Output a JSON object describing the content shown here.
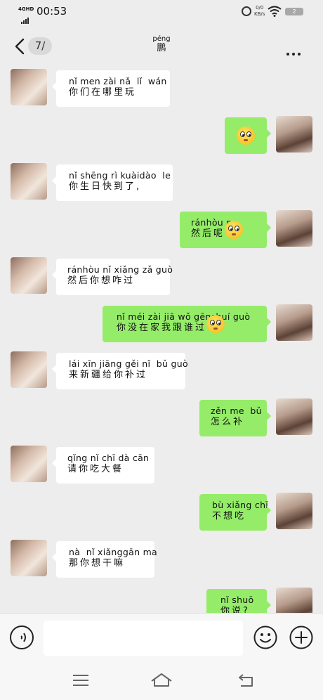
{
  "status_bar": {
    "network": "4GHD",
    "time": "00:53",
    "speed_value": "0/0",
    "speed_unit": "KB/s",
    "battery": "2"
  },
  "header": {
    "unread_count": "7/",
    "title_pinyin": "péng",
    "title_hanzi": "鹏"
  },
  "messages": [
    {
      "side": "left",
      "pinyin": "nǐ men zài nǎ  lǐ  wán",
      "hanzi": "你们在哪里玩"
    },
    {
      "side": "right",
      "pinyin": "",
      "hanzi": "",
      "emoji": "flushed-emoji"
    },
    {
      "side": "left",
      "pinyin": "nǐ shēng rì kuàidào  le",
      "hanzi": "你生日快到了,"
    },
    {
      "side": "right",
      "pinyin": "ránhòu ne",
      "hanzi": "然后呢",
      "emoji": "flushed-emoji"
    },
    {
      "side": "left",
      "pinyin": "ránhòu nǐ xiǎng zǎ guò",
      "hanzi": "然后你想咋过"
    },
    {
      "side": "right",
      "pinyin": "nǐ méi zài jiā wǒ gēnshuí guò",
      "hanzi": "你没在家我跟谁过",
      "emoji": "rolling-eyes-emoji"
    },
    {
      "side": "left",
      "pinyin": "lái xīn jiāng gěi nǐ  bǔ guò",
      "hanzi": "来新疆给你补过"
    },
    {
      "side": "right",
      "pinyin": "zěn me  bǔ",
      "hanzi": "怎么补"
    },
    {
      "side": "left",
      "pinyin": "qǐng nǐ chī dà cān",
      "hanzi": "请你吃大餐"
    },
    {
      "side": "right",
      "pinyin": "bù xiǎng chī",
      "hanzi": "不想吃"
    },
    {
      "side": "left",
      "pinyin": "nà  nǐ xiǎnggān ma",
      "hanzi": "那你想干嘛"
    },
    {
      "side": "right",
      "pinyin": "nǐ shuō",
      "hanzi": "你说?"
    }
  ],
  "input": {
    "placeholder": ""
  },
  "colors": {
    "background": "#ededed",
    "bubble_self": "#95ec69",
    "bubble_other": "#ffffff"
  }
}
